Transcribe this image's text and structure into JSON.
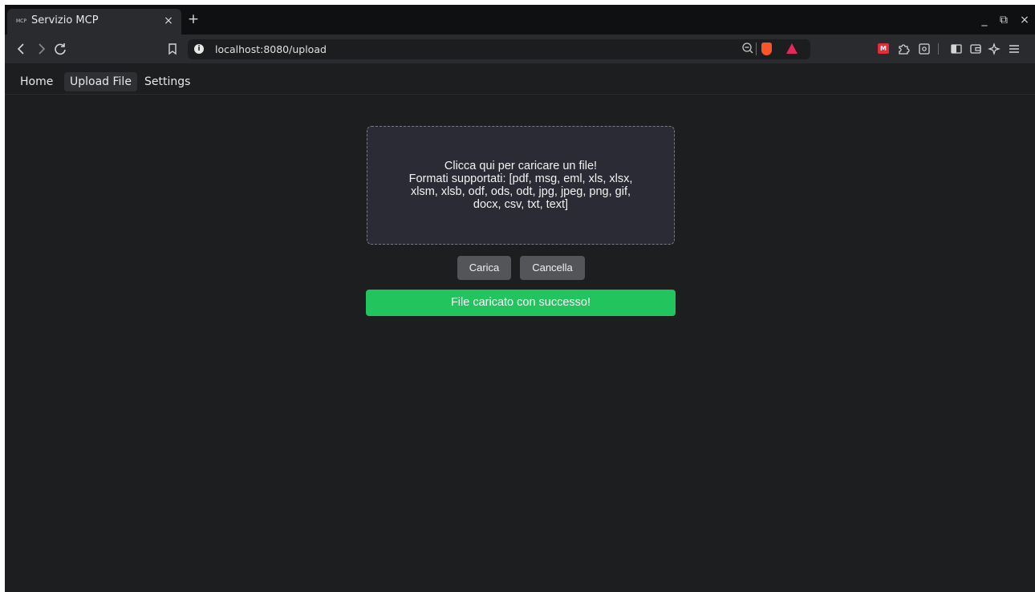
{
  "browser": {
    "tab": {
      "favicon": "MCP",
      "title": "Servizio MCP",
      "close": "×"
    },
    "new_tab": "+",
    "window_controls": {
      "minimize": "_",
      "restore": "⧉",
      "close": "×"
    },
    "url": "localhost:8080/upload",
    "ext_badge": "M"
  },
  "nav": {
    "items": [
      {
        "label": "Home"
      },
      {
        "label": "Upload File"
      },
      {
        "label": "Settings"
      }
    ]
  },
  "upload": {
    "dropzone_title": "Clicca qui per caricare un file!",
    "dropzone_formats": "Formati supportati: [pdf, msg, eml, xls, xlsx, xlsm, xlsb, odf, ods, odt, jpg, jpeg, png, gif, docx, csv, txt, text]",
    "upload_button": "Carica",
    "cancel_button": "Cancella",
    "success_message": "File caricato con successo!"
  },
  "colors": {
    "success": "#22c45e",
    "dropzone_bg": "#2b2b35",
    "page_bg": "#1d1e20"
  }
}
